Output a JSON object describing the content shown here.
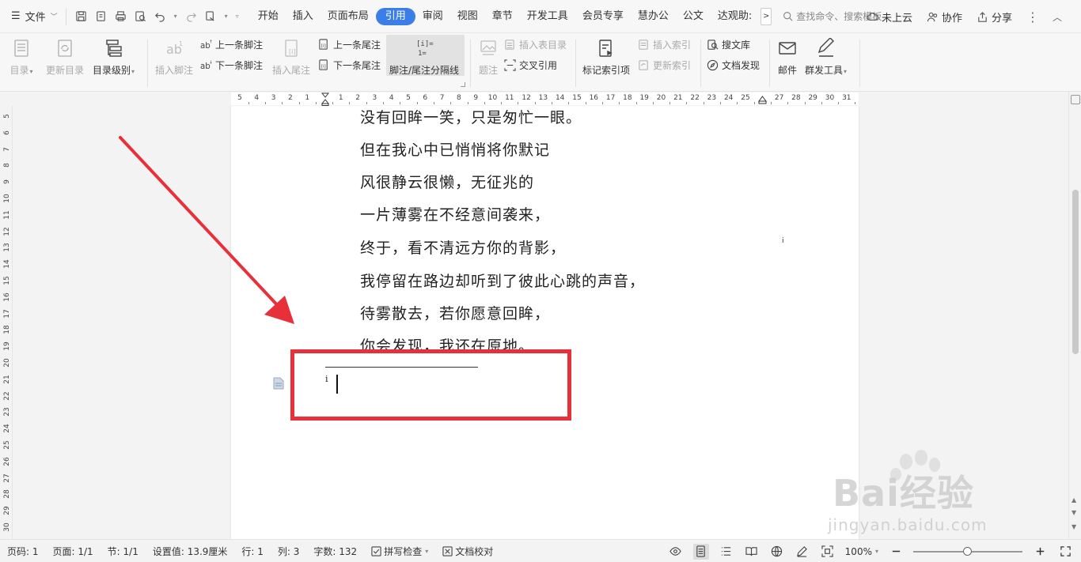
{
  "menubar": {
    "file_label": "文件",
    "tabs": [
      {
        "label": "开始",
        "active": false
      },
      {
        "label": "插入",
        "active": false
      },
      {
        "label": "页面布局",
        "active": false
      },
      {
        "label": "引用",
        "active": true
      },
      {
        "label": "审阅",
        "active": false
      },
      {
        "label": "视图",
        "active": false
      },
      {
        "label": "章节",
        "active": false
      },
      {
        "label": "开发工具",
        "active": false
      },
      {
        "label": "会员专享",
        "active": false
      },
      {
        "label": "慧办公",
        "active": false
      },
      {
        "label": "公文",
        "active": false
      },
      {
        "label": "达观助:",
        "active": false
      }
    ],
    "search_placeholder": "查找命令、搜索模板",
    "cloud_label": "未上云",
    "collab_label": "协作",
    "share_label": "分享"
  },
  "ribbon": {
    "toc_label": "目录",
    "update_toc_label": "更新目录",
    "toc_level_label": "目录级别",
    "insert_footnote_label": "插入脚注",
    "prev_footnote_label": "上一条脚注",
    "next_footnote_label": "下一条脚注",
    "insert_endnote_label": "插入尾注",
    "prev_endnote_label": "上一条尾注",
    "next_endnote_label": "下一条尾注",
    "separator_label": "脚注/尾注分隔线",
    "caption_label": "题注",
    "insert_table_toc_label": "插入表目录",
    "cross_ref_label": "交叉引用",
    "mark_index_label": "标记索引项",
    "insert_index_label": "插入索引",
    "update_index_label": "更新索引",
    "search_lib_label": "搜文库",
    "doc_discover_label": "文档发现",
    "mail_label": "邮件",
    "group_tools_label": "群发工具"
  },
  "ruler": {
    "numbers": [
      "5",
      "4",
      "3",
      "2",
      "1",
      "",
      "1",
      "2",
      "3",
      "4",
      "5",
      "6",
      "7",
      "8",
      "9",
      "10",
      "11",
      "12",
      "13",
      "14",
      "15",
      "16",
      "17",
      "18",
      "19",
      "20",
      "21",
      "22",
      "23",
      "24",
      "25",
      "",
      "27",
      "28",
      "29",
      "30",
      "31"
    ],
    "vertical_numbers": [
      "5",
      "6",
      "7",
      "8",
      "9",
      "10",
      "11",
      "12",
      "13",
      "14",
      "15",
      "16",
      "17",
      "18",
      "19",
      "20",
      "21",
      "22",
      "23",
      "24",
      "25",
      "26",
      "27",
      "28",
      "29",
      "30"
    ]
  },
  "document": {
    "lines": [
      "没有回眸一笑，只是匆忙一眼。",
      "但在我心中已悄悄将你默记",
      "风很静云很懒，无征兆的",
      "一片薄雾在不经意间袭来，",
      "终于，看不清远方你的背影，",
      "我停留在路边却听到了彼此心跳的声音，",
      "待雾散去，若你愿意回眸，",
      "你会发现，我还在原地。"
    ],
    "footnote_ref_mark": "i",
    "footnote_mark": "i"
  },
  "watermark": {
    "brand": "Bai经验",
    "url": "jingyan.baidu.com"
  },
  "statusbar": {
    "page_code": "页码: 1",
    "page_count": "页面: 1/1",
    "section": "节: 1/1",
    "position": "设置值: 13.9厘米",
    "row": "行: 1",
    "column": "列: 3",
    "word_count": "字数: 132",
    "spell_check": "拼写检查",
    "doc_proof": "文档校对",
    "zoom": "100%",
    "zoom_level": 0.5
  },
  "colors": {
    "accent": "#3b7ee8",
    "highlight": "#e8303a"
  }
}
